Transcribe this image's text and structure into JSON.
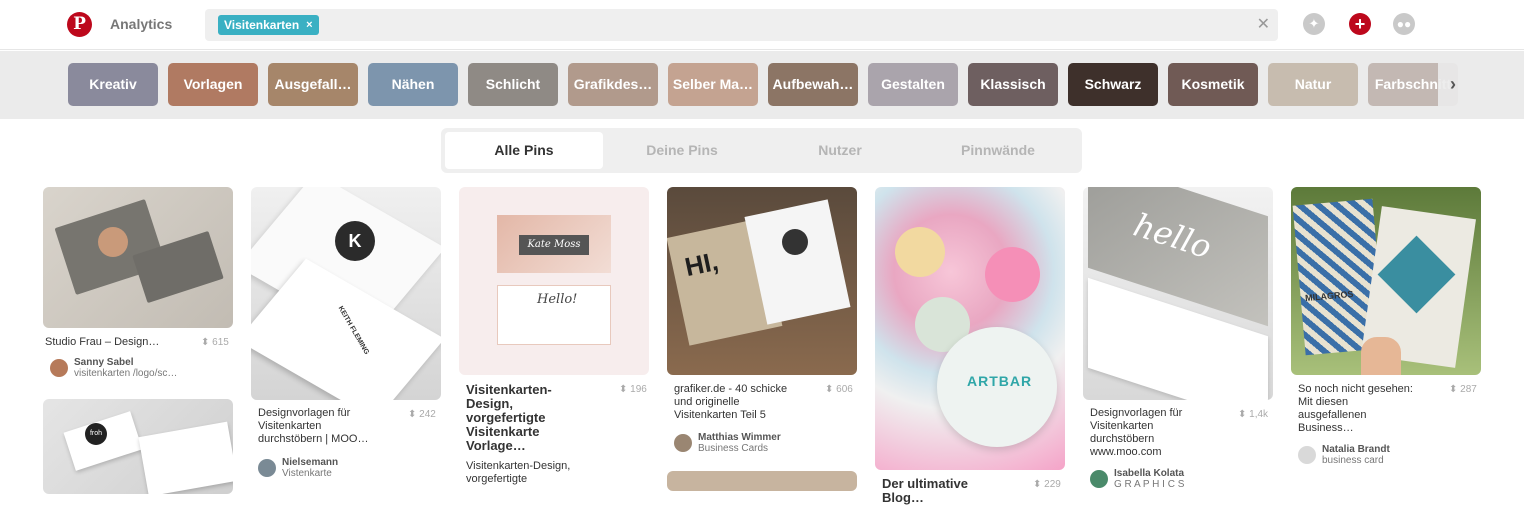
{
  "header": {
    "logo": "P",
    "analytics": "Analytics",
    "search_chip": "Visitenkarten",
    "chip_close": "×",
    "search_clear": "✕",
    "compass_icon": "✦",
    "plus_icon": "+",
    "chat_icon": "●●"
  },
  "guides": {
    "items": [
      {
        "label": "Kreativ",
        "color": "#8a8a9c"
      },
      {
        "label": "Vorlagen",
        "color": "#b07a62"
      },
      {
        "label": "Ausgefall…",
        "color": "#a6866a"
      },
      {
        "label": "Nähen",
        "color": "#7d95ad"
      },
      {
        "label": "Schlicht",
        "color": "#8f8a85"
      },
      {
        "label": "Grafikdes…",
        "color": "#b19a8c"
      },
      {
        "label": "Selber Ma…",
        "color": "#c4a391"
      },
      {
        "label": "Aufbewah…",
        "color": "#8c7565"
      },
      {
        "label": "Gestalten",
        "color": "#aaa4ac"
      },
      {
        "label": "Klassisch",
        "color": "#6e5f60"
      },
      {
        "label": "Schwarz",
        "color": "#3e302b"
      },
      {
        "label": "Kosmetik",
        "color": "#705a55"
      },
      {
        "label": "Natur",
        "color": "#c7bcaf"
      },
      {
        "label": "Farbschnitt",
        "color": "#c3b8b3"
      }
    ],
    "next": "›"
  },
  "tabs": [
    {
      "label": "Alle Pins"
    },
    {
      "label": "Deine Pins"
    },
    {
      "label": "Nutzer"
    },
    {
      "label": "Pinnwände"
    }
  ],
  "pins": {
    "p1": {
      "title": "Studio Frau – Design…",
      "count": "⬍ 615",
      "user": "Sanny Sabel",
      "board": "visitenkarten /logo/sc…"
    },
    "p2": {
      "title": "Designvorlagen für Visitenkarten durchstöbern | MOO…",
      "count": "⬍ 242",
      "user": "Nielsemann",
      "board": "Vistenkarte"
    },
    "p3": {
      "title": "Visitenkarten-Design, vorgefertigte Visitenkarte Vorlage…",
      "count": "⬍ 196",
      "desc": "Visitenkarten-Design, vorgefertigte",
      "card_name": "Kate Moss",
      "card_hello": "Hello!"
    },
    "p4": {
      "title": "grafiker.de - 40 schicke und originelle Visitenkarten Teil 5",
      "count": "⬍ 606",
      "user": "Matthias Wimmer",
      "board": "Business Cards",
      "card_text": "HI,"
    },
    "p5": {
      "title": "Der ultimative Blog…",
      "count": "⬍ 229",
      "card_text": "ARTBAR"
    },
    "p6": {
      "title": "Designvorlagen für Visitenkarten durchstöbern www.moo.com",
      "count": "⬍ 1,4k",
      "user": "Isabella Kolata",
      "board": "G R A P H I C S",
      "card_text": "hello"
    },
    "p7": {
      "title": "So noch nicht gesehen: Mit diesen ausgefallenen Business…",
      "count": "⬍ 287",
      "user": "Natalia Brandt",
      "board": "business card",
      "card_text": "MILAGROS"
    },
    "p2_card": "K",
    "p2_name": "KEITH FLEMING",
    "p8_card": "froh"
  }
}
